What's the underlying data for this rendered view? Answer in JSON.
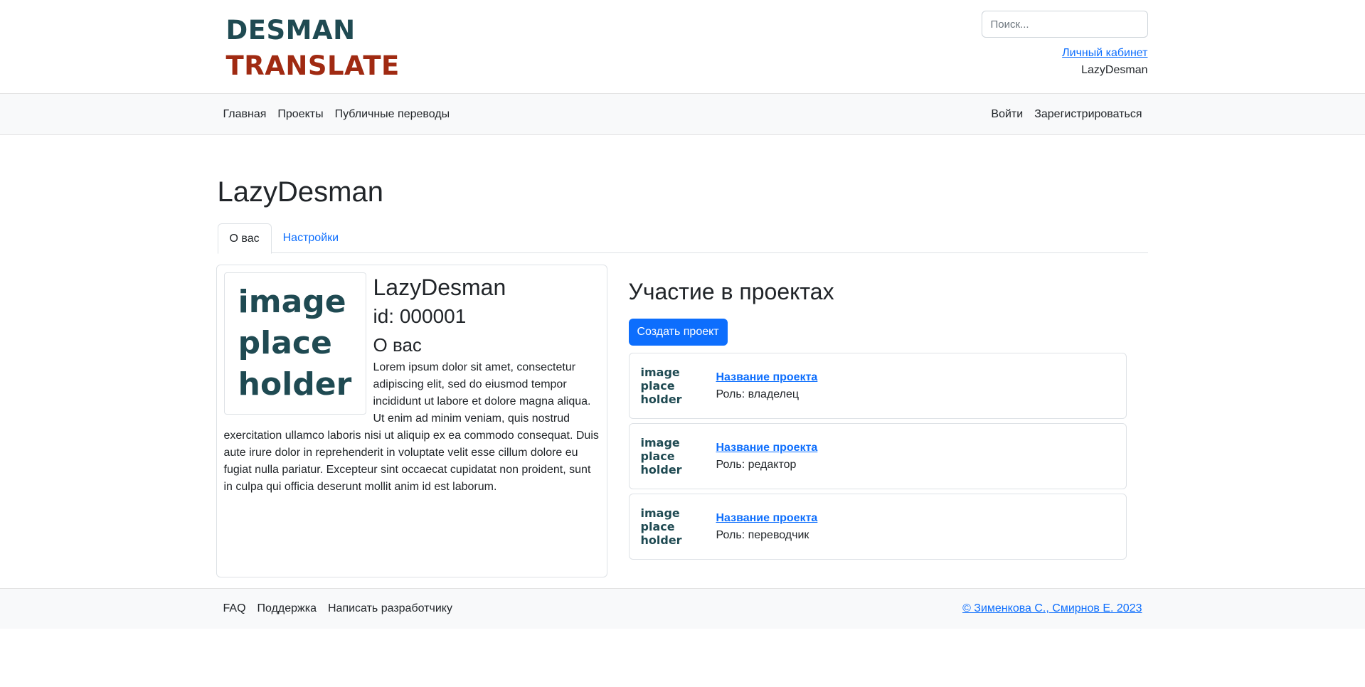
{
  "header": {
    "logo_line1": "DESMAN",
    "logo_line2": "TRANSLATE",
    "search_placeholder": "Поиск...",
    "account_link": "Личный кабинет",
    "username": "LazyDesman"
  },
  "nav": {
    "left": [
      "Главная",
      "Проекты",
      "Публичные переводы"
    ],
    "right": [
      "Войти",
      "Зарегистрироваться"
    ]
  },
  "page": {
    "title": "LazyDesman",
    "tabs": [
      {
        "label": "О вас",
        "active": true
      },
      {
        "label": "Настройки",
        "active": false
      }
    ]
  },
  "profile": {
    "avatar_text": [
      "image",
      "place",
      "holder"
    ],
    "name": "LazyDesman",
    "id": "id: 000001",
    "about_heading": "О вас",
    "bio": "Lorem ipsum dolor sit amet, consectetur adipiscing elit, sed do eiusmod tempor incididunt ut labore et dolore magna aliqua. Ut enim ad minim veniam, quis nostrud exercitation ullamco laboris nisi ut aliquip ex ea commodo consequat. Duis aute irure dolor in reprehenderit in voluptate velit esse cillum dolore eu fugiat nulla pariatur. Excepteur sint occaecat cupidatat non proident, sunt in culpa qui officia deserunt mollit anim id est laborum."
  },
  "projects": {
    "title": "Участие в проектах",
    "create_button": "Создать проект",
    "items": [
      {
        "thumb": [
          "image",
          "place",
          "holder"
        ],
        "name": "Название проекта",
        "role": "Роль: владелец"
      },
      {
        "thumb": [
          "image",
          "place",
          "holder"
        ],
        "name": "Название проекта",
        "role": "Роль: редактор"
      },
      {
        "thumb": [
          "image",
          "place",
          "holder"
        ],
        "name": "Название проекта",
        "role": "Роль: переводчик"
      }
    ]
  },
  "footer": {
    "links": [
      "FAQ",
      "Поддержка",
      "Написать разработчику"
    ],
    "copyright": "© Зименкова С., Смирнов Е. 2023"
  },
  "colors": {
    "brand_dark": "#1f4a52",
    "brand_red": "#a02a12",
    "primary": "#0d6efd"
  }
}
